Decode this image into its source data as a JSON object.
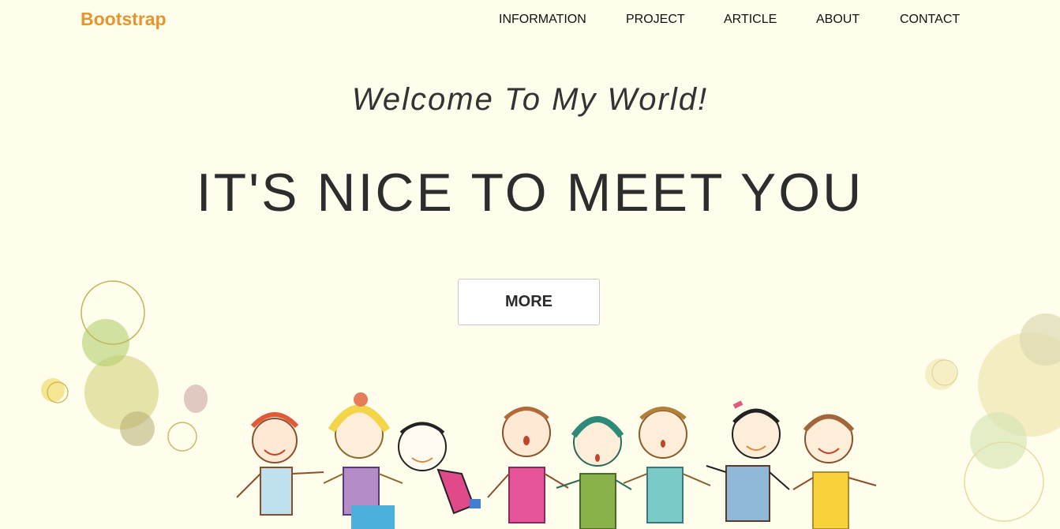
{
  "header": {
    "brand": "Bootstrap",
    "nav": [
      {
        "label": "INFORMATION"
      },
      {
        "label": "PROJECT"
      },
      {
        "label": "ARTICLE"
      },
      {
        "label": "ABOUT"
      },
      {
        "label": "CONTACT"
      }
    ]
  },
  "hero": {
    "welcome": "Welcome To My World!",
    "headline": "IT'S NICE TO MEET YOU",
    "button_label": "MORE"
  },
  "colors": {
    "background": "#fffdeb",
    "brand": "#e4952e",
    "text": "#2d2d2d"
  }
}
